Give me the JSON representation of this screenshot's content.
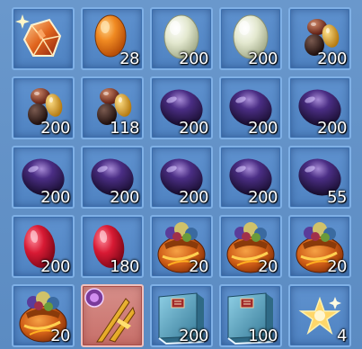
{
  "inventory": {
    "slots": [
      {
        "item": "crystal-gem-icon",
        "quantity": ""
      },
      {
        "item": "orange-egg-icon",
        "quantity": "28"
      },
      {
        "item": "pale-green-egg-icon",
        "quantity": "200"
      },
      {
        "item": "pale-green-egg-icon",
        "quantity": "200"
      },
      {
        "item": "mixed-beans-icon",
        "quantity": "200"
      },
      {
        "item": "mixed-beans-icon",
        "quantity": "200"
      },
      {
        "item": "mixed-beans-icon",
        "quantity": "118"
      },
      {
        "item": "dark-purple-orb-icon",
        "quantity": "200"
      },
      {
        "item": "dark-purple-orb-icon",
        "quantity": "200"
      },
      {
        "item": "dark-purple-orb-icon",
        "quantity": "200"
      },
      {
        "item": "dark-purple-orb-icon",
        "quantity": "200"
      },
      {
        "item": "dark-purple-orb-icon",
        "quantity": "200"
      },
      {
        "item": "dark-purple-orb-icon",
        "quantity": "200"
      },
      {
        "item": "dark-purple-orb-icon",
        "quantity": "200"
      },
      {
        "item": "dark-purple-orb-icon",
        "quantity": "55"
      },
      {
        "item": "red-gem-icon",
        "quantity": "200"
      },
      {
        "item": "red-gem-icon",
        "quantity": "180"
      },
      {
        "item": "treasure-pouch-icon",
        "quantity": "20"
      },
      {
        "item": "treasure-pouch-icon",
        "quantity": "20"
      },
      {
        "item": "treasure-pouch-icon",
        "quantity": "20"
      },
      {
        "item": "treasure-pouch-icon",
        "quantity": "20"
      },
      {
        "item": "golden-weapon-icon",
        "quantity": ""
      },
      {
        "item": "blue-book-icon",
        "quantity": "200"
      },
      {
        "item": "blue-book-icon",
        "quantity": "100"
      },
      {
        "item": "star-sparkle-icon",
        "quantity": "4"
      }
    ],
    "colors": {
      "slot_bg": "#5b8fcf",
      "slot_border": "#7fb0e6",
      "selected_bg": "#cf7f79",
      "quantity_text": "#ffffff"
    }
  }
}
